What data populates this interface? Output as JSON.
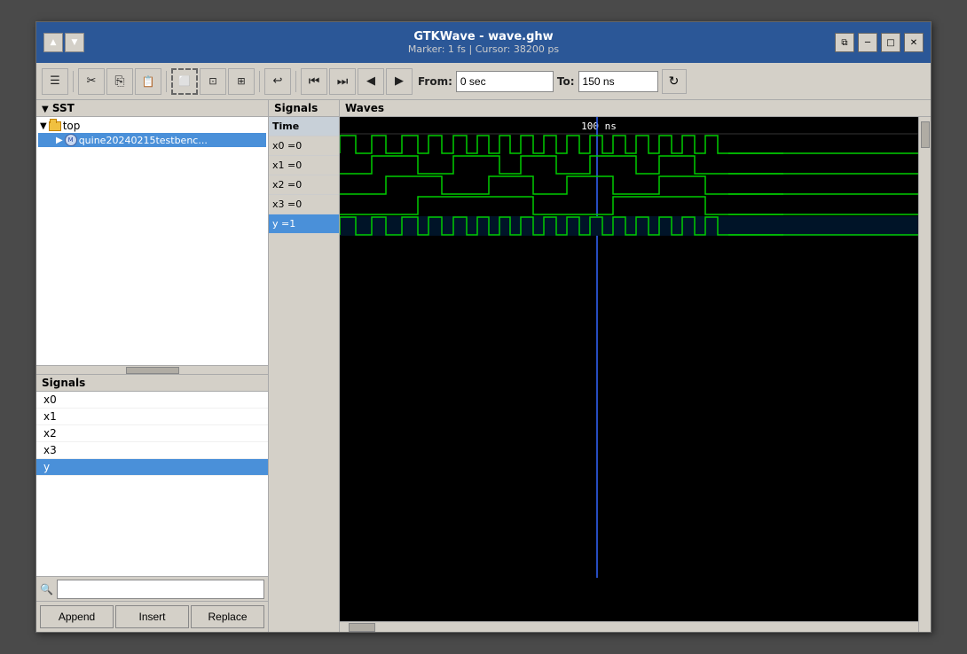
{
  "window": {
    "title": "GTKWave - wave.ghw",
    "subtitle": "Marker: 1 fs  |  Cursor: 38200 ps"
  },
  "toolbar": {
    "from_label": "From:",
    "from_value": "0 sec",
    "to_label": "To:",
    "to_value": "150 ns",
    "buttons": [
      {
        "id": "hamburger",
        "icon": "☰",
        "label": "menu"
      },
      {
        "id": "cut",
        "icon": "✂",
        "label": "cut"
      },
      {
        "id": "copy",
        "icon": "⎘",
        "label": "copy"
      },
      {
        "id": "paste",
        "icon": "📋",
        "label": "paste"
      },
      {
        "id": "select-all",
        "icon": "⬜",
        "label": "select-all"
      },
      {
        "id": "zoom-fit",
        "icon": "⊡",
        "label": "zoom-fit"
      },
      {
        "id": "zoom-box",
        "icon": "⊞",
        "label": "zoom-box"
      },
      {
        "id": "undo",
        "icon": "↩",
        "label": "undo"
      },
      {
        "id": "first",
        "icon": "⏮",
        "label": "first"
      },
      {
        "id": "fast-fwd",
        "icon": "⏭",
        "label": "fast-fwd"
      },
      {
        "id": "prev",
        "icon": "◀",
        "label": "prev"
      },
      {
        "id": "next",
        "icon": "▶",
        "label": "next"
      }
    ]
  },
  "sst": {
    "header": "SST",
    "tree": [
      {
        "label": "top",
        "type": "folder",
        "expanded": true,
        "indent": 0
      },
      {
        "label": "quine20240215testbenc...",
        "type": "module",
        "expanded": false,
        "indent": 1,
        "selected": true
      }
    ]
  },
  "signals_panel": {
    "header": "Signals",
    "items": [
      {
        "name": "x0",
        "selected": false
      },
      {
        "name": "x1",
        "selected": false
      },
      {
        "name": "x2",
        "selected": false
      },
      {
        "name": "x3",
        "selected": false
      },
      {
        "name": "y",
        "selected": true
      }
    ],
    "search_placeholder": ""
  },
  "bottom_buttons": {
    "append": "Append",
    "insert": "Insert",
    "replace": "Replace"
  },
  "waves": {
    "signals_col_header": "Signals",
    "waves_col_header": "Waves",
    "signal_rows": [
      {
        "label": "Time",
        "value": "",
        "selected": false,
        "header": true
      },
      {
        "label": "x0 =0",
        "value": "0",
        "selected": false
      },
      {
        "label": "x1 =0",
        "value": "0",
        "selected": false
      },
      {
        "label": "x2 =0",
        "value": "0",
        "selected": false
      },
      {
        "label": "x3 =0",
        "value": "0",
        "selected": false
      },
      {
        "label": "y =1",
        "value": "1",
        "selected": true
      }
    ],
    "time_marker": "100 ns",
    "cursor_pos_pct": 42
  }
}
